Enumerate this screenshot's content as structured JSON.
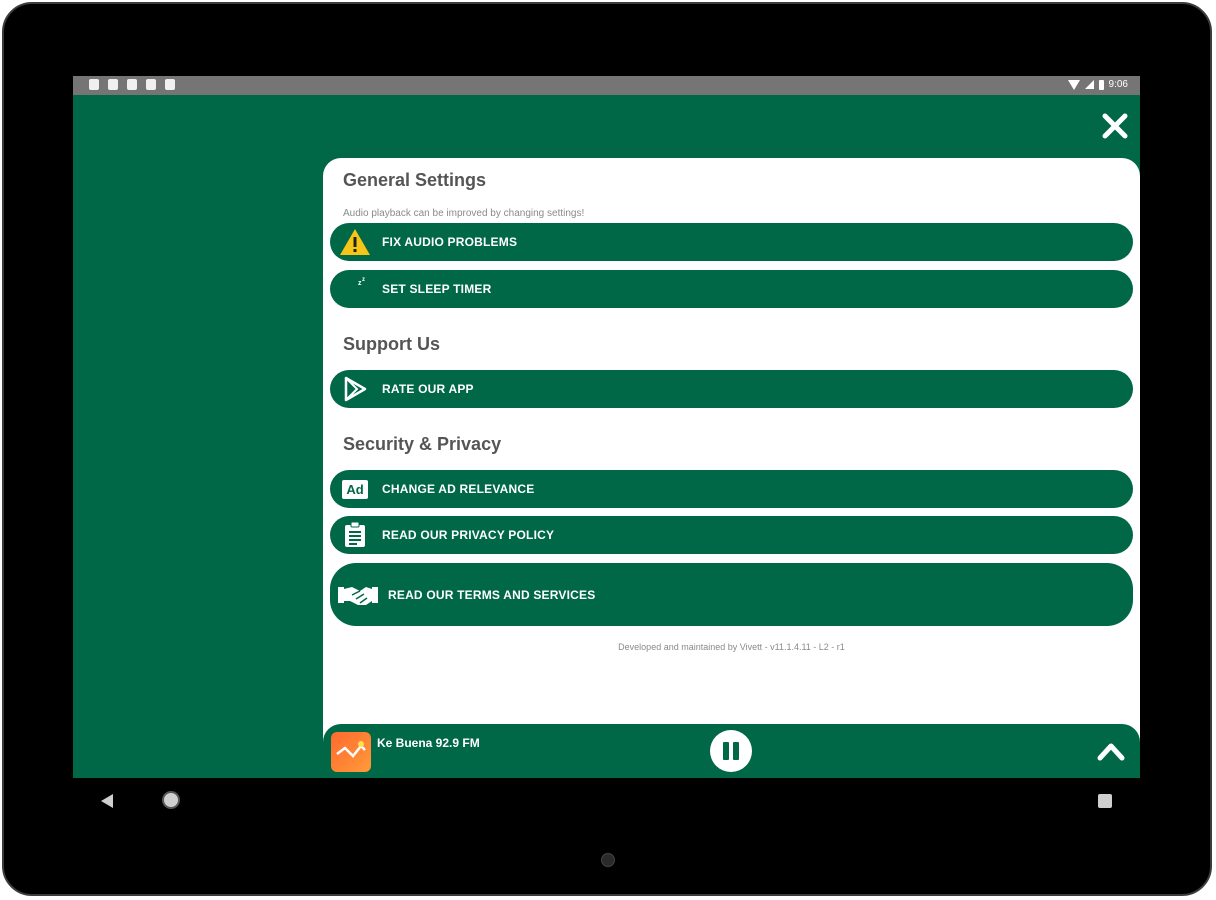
{
  "status_bar": {
    "time": "9:06"
  },
  "header": {
    "close_icon": "close-icon"
  },
  "general": {
    "title": "General Settings",
    "subtitle": "Audio playback can be improved by changing settings!",
    "fix_audio": "FIX AUDIO PROBLEMS",
    "sleep_timer": "SET SLEEP TIMER"
  },
  "support": {
    "title": "Support Us",
    "rate_app": "RATE OUR APP"
  },
  "security": {
    "title": "Security & Privacy",
    "ad_relevance": "CHANGE AD RELEVANCE",
    "ad_badge": "Ad",
    "privacy_policy": "READ OUR PRIVACY POLICY",
    "terms": "READ OUR TERMS AND SERVICES"
  },
  "credit": "Developed and maintained by Vivett - v11.1.4.11 - L2 - r1",
  "player": {
    "station": "Ke Buena 92.9 FM",
    "state": "playing"
  },
  "colors": {
    "brand": "#006847",
    "warning": "#f5c518",
    "statusbar": "#757575"
  }
}
